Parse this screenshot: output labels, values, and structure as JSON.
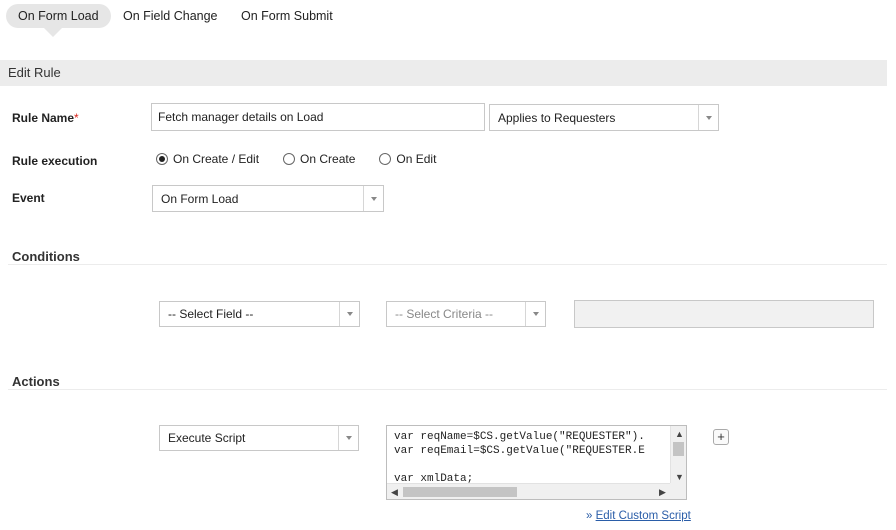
{
  "tabs": [
    {
      "label": "On Form Load",
      "active": true
    },
    {
      "label": "On Field Change",
      "active": false
    },
    {
      "label": "On Form Submit",
      "active": false
    }
  ],
  "edit_rule": {
    "header": "Edit Rule",
    "rule_name_label": "Rule Name",
    "required_marker": "*",
    "rule_name_value": "Fetch manager details on Load",
    "applies_to": "Applies to Requesters",
    "rule_execution_label": "Rule execution",
    "rule_execution_options": [
      {
        "label": "On Create / Edit",
        "checked": true
      },
      {
        "label": "On Create",
        "checked": false
      },
      {
        "label": "On Edit",
        "checked": false
      }
    ],
    "event_label": "Event",
    "event_value": "On Form Load"
  },
  "conditions": {
    "title": "Conditions",
    "field_select": "-- Select Field --",
    "criteria_select": "-- Select Criteria --",
    "value_input": ""
  },
  "actions": {
    "title": "Actions",
    "action_select": "Execute Script",
    "script_lines": [
      "var reqName=$CS.getValue(\"REQUESTER\").",
      "var reqEmail=$CS.getValue(\"REQUESTER.E",
      "",
      "var xmlData;"
    ],
    "add_button": "+",
    "edit_link_prefix": "» ",
    "edit_link_label": "Edit Custom Script"
  },
  "icons": {
    "dropdown": "chevron-down-icon",
    "scroll_up": "arrow-up-icon",
    "scroll_down": "arrow-down-icon",
    "scroll_left": "arrow-left-icon",
    "scroll_right": "arrow-right-icon"
  },
  "colors": {
    "section_bg": "#ececec",
    "tab_active_bg": "#e6e6e6",
    "required": "#d9251c",
    "link": "#2a5da8"
  }
}
